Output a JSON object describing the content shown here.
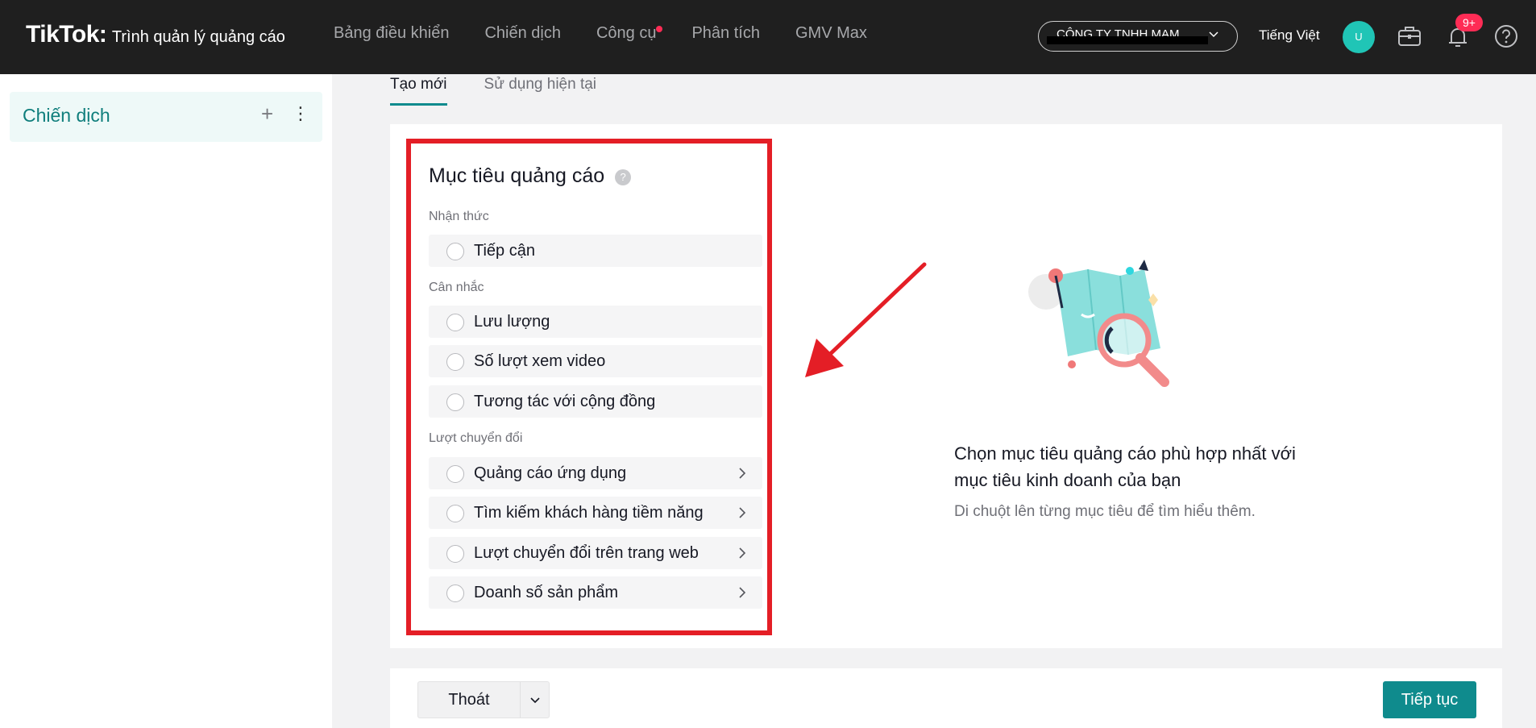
{
  "header": {
    "logo": "TikTok",
    "product": "Trình quản lý quảng cáo",
    "nav": [
      {
        "label": "Bảng điều khiển"
      },
      {
        "label": "Chiến dịch"
      },
      {
        "label": "Công cụ"
      },
      {
        "label": "Phân tích"
      },
      {
        "label": "GMV Max"
      }
    ],
    "account": "CÔNG TY TNHH MAM...",
    "language": "Tiếng Việt",
    "avatar_initial": "U",
    "notification_badge": "9+"
  },
  "sidebar": {
    "title": "Chiến dịch",
    "add_symbol": "+",
    "more_symbol": "⋮"
  },
  "tabs": [
    {
      "label": "Tạo mới",
      "active": true
    },
    {
      "label": "Sử dụng hiện tại",
      "active": false
    }
  ],
  "objectives": {
    "title": "Mục tiêu quảng cáo",
    "help_symbol": "?",
    "groups": [
      {
        "label": "Nhận thức",
        "options": [
          {
            "label": "Tiếp cận",
            "has_arrow": false
          }
        ]
      },
      {
        "label": "Cân nhắc",
        "options": [
          {
            "label": "Lưu lượng",
            "has_arrow": false
          },
          {
            "label": "Số lượt xem video",
            "has_arrow": false
          },
          {
            "label": "Tương tác với cộng đồng",
            "has_arrow": false
          }
        ]
      },
      {
        "label": "Lượt chuyển đổi",
        "options": [
          {
            "label": "Quảng cáo ứng dụng",
            "has_arrow": true
          },
          {
            "label": "Tìm kiếm khách hàng tiềm năng",
            "has_arrow": true
          },
          {
            "label": "Lượt chuyển đổi trên trang web",
            "has_arrow": true
          },
          {
            "label": "Doanh số sản phẩm",
            "has_arrow": true
          }
        ]
      }
    ]
  },
  "hint": {
    "title": "Chọn mục tiêu quảng cáo phù hợp nhất với mục tiêu kinh doanh của bạn",
    "subtitle": "Di chuột lên từng mục tiêu để tìm hiểu thêm."
  },
  "footer": {
    "exit_label": "Thoát",
    "next_label": "Tiếp tục"
  },
  "colors": {
    "accent": "#0f8b8d",
    "highlight_box": "#e41e26",
    "annotation_arrow": "#e41e26",
    "badge": "#fe2c55"
  }
}
